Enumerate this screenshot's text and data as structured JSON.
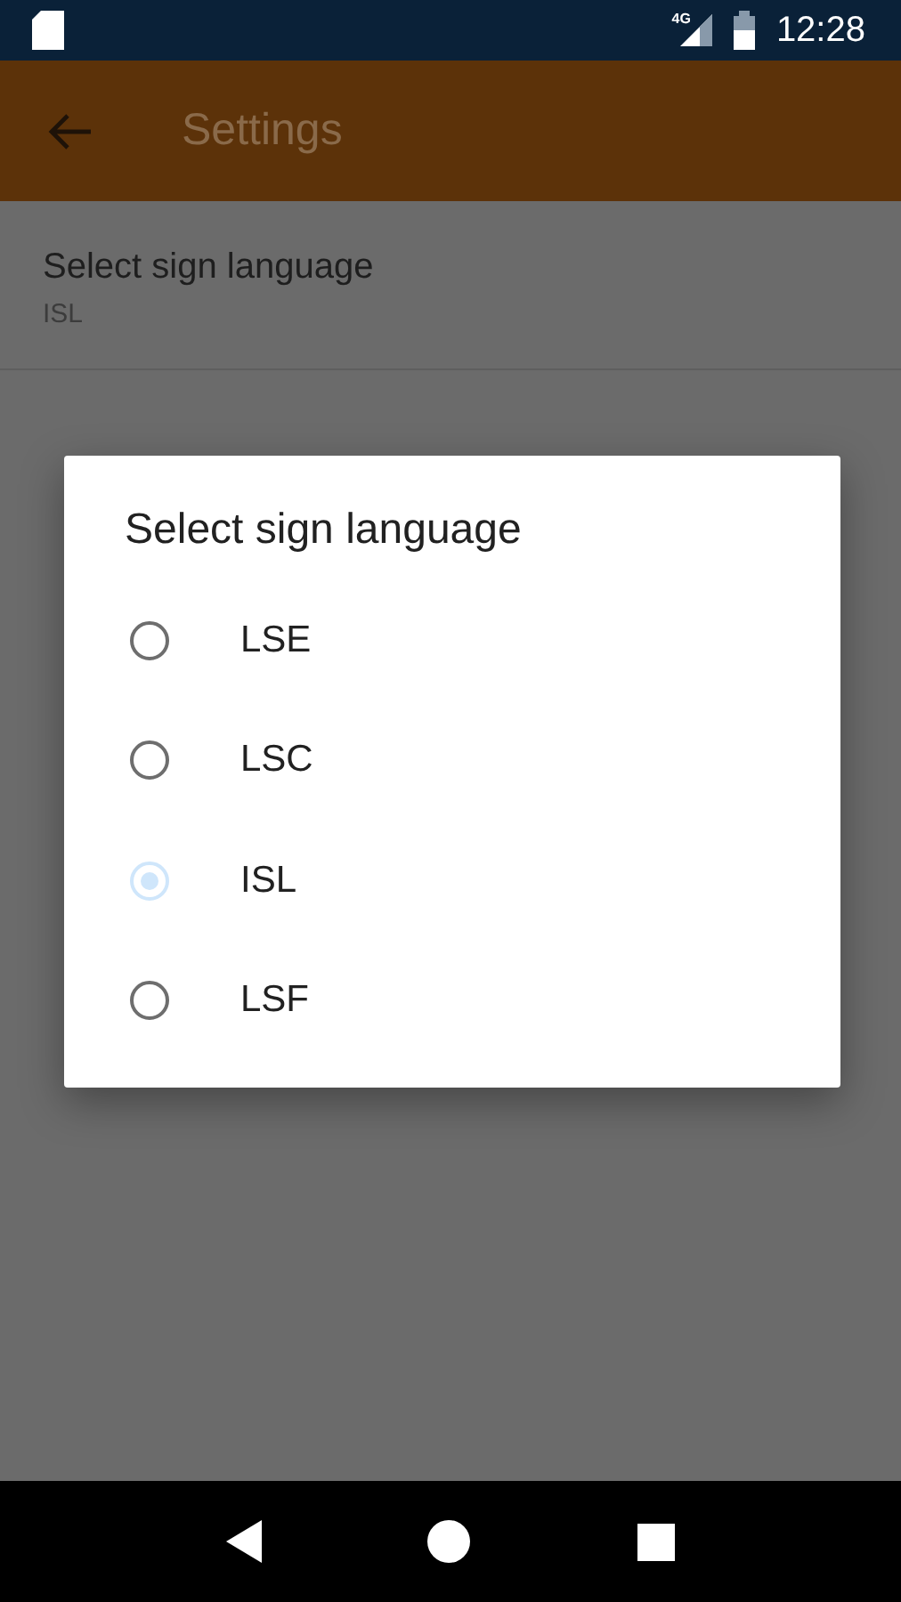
{
  "status_bar": {
    "network": "4G",
    "time": "12:28"
  },
  "app_bar": {
    "title": "Settings"
  },
  "setting": {
    "title": "Select sign language",
    "value": "ISL"
  },
  "dialog": {
    "title": "Select sign language",
    "options": [
      {
        "label": "LSE",
        "selected": false
      },
      {
        "label": "LSC",
        "selected": false
      },
      {
        "label": "ISL",
        "selected": true
      },
      {
        "label": "LSF",
        "selected": false
      }
    ]
  }
}
